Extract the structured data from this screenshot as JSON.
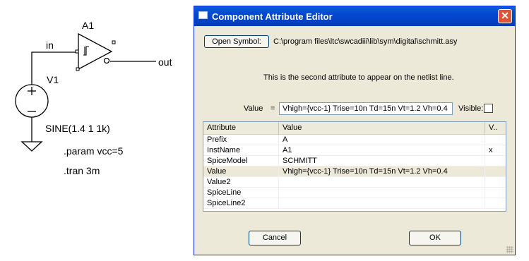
{
  "schematic": {
    "component_name": "A1",
    "input_label": "in",
    "output_label": "out",
    "source_name": "V1",
    "source_value": "SINE(1.4 1 1k)",
    "param_directive": ".param vcc=5",
    "tran_directive": ".tran 3m"
  },
  "dialog": {
    "title": "Component Attribute Editor",
    "close_glyph": "✕",
    "open_symbol_label": "Open Symbol:",
    "symbol_path": "C:\\program files\\ltc\\swcadiii\\lib\\sym\\digital\\schmitt.asy",
    "description": "This is the second attribute to appear on the netlist line.",
    "value_label": "Value",
    "value_equals": "=",
    "value_field": "Vhigh={vcc-1} Trise=10n Td=15n Vt=1.2 Vh=0.4",
    "visible_label": "Visible:",
    "visible_checked": false,
    "table": {
      "headers": [
        "Attribute",
        "Value",
        "V.."
      ],
      "rows": [
        {
          "attribute": "Prefix",
          "value": "A",
          "visible": ""
        },
        {
          "attribute": "InstName",
          "value": "A1",
          "visible": "x"
        },
        {
          "attribute": "SpiceModel",
          "value": "SCHMITT",
          "visible": ""
        },
        {
          "attribute": "Value",
          "value": "Vhigh={vcc-1} Trise=10n Td=15n Vt=1.2 Vh=0.4",
          "visible": ""
        },
        {
          "attribute": "Value2",
          "value": "",
          "visible": ""
        },
        {
          "attribute": "SpiceLine",
          "value": "",
          "visible": ""
        },
        {
          "attribute": "SpiceLine2",
          "value": "",
          "visible": ""
        }
      ],
      "selected_row": 3
    },
    "cancel_label": "Cancel",
    "ok_label": "OK"
  }
}
